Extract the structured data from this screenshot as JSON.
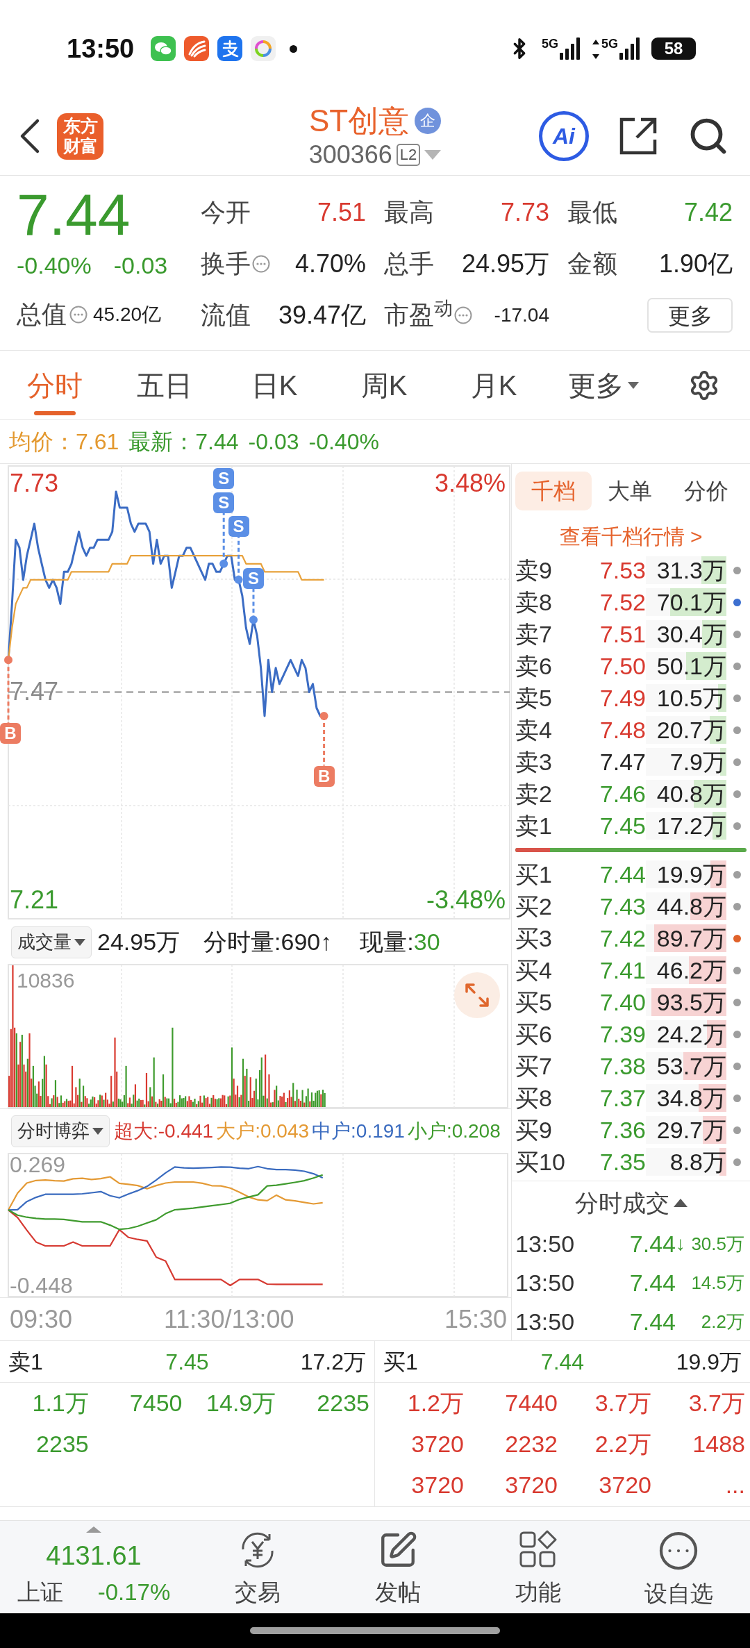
{
  "status_bar": {
    "time": "13:50",
    "networks": [
      {
        "label": "5G",
        "arrows": false
      },
      {
        "label": "5G",
        "arrows": true
      }
    ],
    "battery": "58"
  },
  "header": {
    "logo": "东方财富",
    "title": "ST创意",
    "badge": "企",
    "code": "300366",
    "code_tag": "L2",
    "ai": "Ai"
  },
  "quote": {
    "price": "7.44",
    "color": "#3a9a2e",
    "change_pct": "-0.40%",
    "change": "-0.03",
    "total_value": {
      "label": "总值",
      "value": "45.20亿",
      "info": true
    },
    "stats": [
      {
        "label": "今开",
        "value": "7.51",
        "color": "#d8392f",
        "info": false,
        "kind": "normal"
      },
      {
        "label": "最高",
        "value": "7.73",
        "color": "#d8392f",
        "info": false,
        "kind": "normal"
      },
      {
        "label": "最低",
        "value": "7.42",
        "color": "#3a9a2e",
        "info": false,
        "kind": "normal"
      },
      {
        "label": "换手",
        "value": "4.70%",
        "color": "#222222",
        "info": true,
        "kind": "normal"
      },
      {
        "label": "总手",
        "value": "24.95万",
        "color": "#222222",
        "info": false,
        "kind": "normal"
      },
      {
        "label": "金额",
        "value": "1.90亿",
        "color": "#222222",
        "info": false,
        "kind": "normal"
      },
      {
        "label": "流值",
        "value": "39.47亿",
        "color": "#222222",
        "info": false,
        "kind": "normal"
      },
      {
        "label": "市盈$^{动}$",
        "value": "-17.04",
        "color": "#222222",
        "info": true,
        "kind": "compact"
      }
    ],
    "more_button": "更多"
  },
  "tabs": [
    {
      "label": "分时",
      "selected": true,
      "kind": "tab"
    },
    {
      "label": "五日",
      "selected": false,
      "kind": "tab"
    },
    {
      "label": "日K",
      "selected": false,
      "kind": "tab"
    },
    {
      "label": "周K",
      "selected": false,
      "kind": "tab"
    },
    {
      "label": "月K",
      "selected": false,
      "kind": "tab"
    },
    {
      "label": "更多",
      "selected": false,
      "kind": "menu"
    }
  ],
  "summary": [
    {
      "text": "均价：7.61",
      "kind": "average"
    },
    {
      "text": "最新：7.44",
      "kind": "latest"
    },
    {
      "text": "-0.03",
      "kind": "latest"
    },
    {
      "text": "-0.40%",
      "kind": "latest"
    }
  ],
  "price_chart": {
    "pct_labels": [
      {
        "text": "3.48%",
        "color": "#d8392f"
      },
      {
        "text": "-3.48%",
        "color": "#3a9a2e"
      }
    ],
    "markers": [
      {
        "kind": "buy",
        "text": "B"
      },
      {
        "kind": "sell",
        "text": "S"
      },
      {
        "kind": "sell",
        "text": "S"
      },
      {
        "kind": "sell",
        "text": "S"
      },
      {
        "kind": "sell",
        "text": "S"
      },
      {
        "kind": "buy",
        "text": "B"
      }
    ],
    "chart_data": {
      "type": "line",
      "categories": [
        null,
        null,
        null,
        null,
        null,
        null,
        null,
        null,
        null,
        null,
        null,
        null,
        null,
        null,
        null,
        null,
        null,
        null,
        null,
        null,
        null,
        null,
        null,
        null,
        null,
        null,
        null,
        null,
        null,
        null,
        null,
        null,
        null,
        null,
        null,
        null,
        null,
        null,
        null,
        null,
        null,
        null,
        null,
        null,
        null,
        null,
        null,
        null,
        null,
        null,
        null,
        null,
        null,
        null,
        null,
        null,
        null,
        null,
        null,
        null,
        null,
        null,
        null,
        null,
        null,
        null,
        null,
        null,
        null,
        null,
        null,
        null,
        null,
        null,
        null,
        null,
        null,
        null,
        null,
        null,
        null,
        null,
        null,
        null,
        null,
        null,
        null,
        null,
        null,
        null,
        null,
        null,
        null,
        null,
        null,
        null,
        null,
        null,
        null,
        null,
        null,
        null,
        null,
        null,
        null,
        null,
        null,
        null,
        null,
        null,
        null,
        null,
        null,
        null,
        null,
        null,
        null,
        null,
        null,
        null,
        null,
        null,
        null,
        null,
        null,
        null,
        null,
        null,
        null,
        null,
        null,
        null,
        null,
        null,
        null,
        null
      ],
      "series": [
        {
          "color": "#3b6cc4",
          "values": [
            7.51,
            7.58,
            7.66,
            7.65,
            7.61,
            7.64,
            7.66,
            7.68,
            7.65,
            7.63,
            7.61,
            7.6,
            7.61,
            7.6,
            7.58,
            7.62,
            7.62,
            7.63,
            7.65,
            7.67,
            7.65,
            7.64,
            7.65,
            7.65,
            7.66,
            7.66,
            7.66,
            7.66,
            7.67,
            7.72,
            7.7,
            7.7,
            7.7,
            7.68,
            7.67,
            7.68,
            7.68,
            7.68,
            7.67,
            7.63,
            7.66,
            7.63,
            7.64,
            7.64,
            7.6,
            7.62,
            7.64,
            7.64,
            7.65,
            7.65,
            7.64,
            7.63,
            7.62,
            7.61,
            7.63,
            7.63,
            7.62,
            7.62,
            7.63,
            7.64,
            7.64,
            7.61,
            7.61,
            7.59,
            7.55,
            7.53,
            7.56,
            7.54,
            7.5,
            7.44,
            7.51,
            7.47,
            7.5,
            7.48,
            7.49,
            7.5,
            7.51,
            7.5,
            7.49,
            7.51,
            7.5,
            7.47,
            7.48,
            7.45,
            7.44,
            7.44,
            null,
            null,
            null,
            null,
            null,
            null,
            null,
            null,
            null,
            null,
            null,
            null,
            null,
            null,
            null,
            null,
            null,
            null,
            null,
            null,
            null,
            null,
            null,
            null,
            null,
            null,
            null,
            null,
            null,
            null,
            null,
            null,
            null,
            null,
            null,
            null,
            null,
            null,
            null,
            null,
            null,
            null,
            null,
            null,
            null,
            null,
            null,
            null,
            null,
            null
          ]
        },
        {
          "color": "#e8a23c",
          "values": [
            7.51,
            7.55,
            7.58,
            7.59,
            7.6,
            7.6,
            7.61,
            7.61,
            7.61,
            7.61,
            7.61,
            7.61,
            7.61,
            7.61,
            7.61,
            7.61,
            7.61,
            7.62,
            7.62,
            7.62,
            7.62,
            7.62,
            7.62,
            7.62,
            7.62,
            7.62,
            7.62,
            7.62,
            7.63,
            7.63,
            7.63,
            7.63,
            7.63,
            7.64,
            7.64,
            7.64,
            7.64,
            7.64,
            7.64,
            7.64,
            7.64,
            7.64,
            7.64,
            7.64,
            7.64,
            7.64,
            7.64,
            7.64,
            7.64,
            7.64,
            7.64,
            7.64,
            7.64,
            7.64,
            7.64,
            7.64,
            7.64,
            7.64,
            7.64,
            7.64,
            7.64,
            7.64,
            7.64,
            7.64,
            7.63,
            7.63,
            7.63,
            7.63,
            7.63,
            7.62,
            7.62,
            7.62,
            7.62,
            7.62,
            7.62,
            7.62,
            7.62,
            7.62,
            7.62,
            7.61,
            7.61,
            7.61,
            7.61,
            7.61,
            7.61,
            7.61,
            null,
            null,
            null,
            null,
            null,
            null,
            null,
            null,
            null,
            null,
            null,
            null,
            null,
            null,
            null,
            null,
            null,
            null,
            null,
            null,
            null,
            null,
            null,
            null,
            null,
            null,
            null,
            null,
            null,
            null,
            null,
            null,
            null,
            null,
            null,
            null,
            null,
            null,
            null,
            null,
            null,
            null,
            null,
            null,
            null,
            null,
            null,
            null,
            null,
            null
          ]
        }
      ],
      "ylim": [
        7.187,
        7.752
      ],
      "yticks": [
        {
          "value": 7.73,
          "label": "7.73"
        },
        {
          "value": 7.47,
          "label": "7.47"
        },
        {
          "value": 7.21,
          "label": "7.21"
        }
      ],
      "ref_lines": [
        {
          "axis": "y",
          "value": 7.47
        }
      ],
      "grid": true
    }
  },
  "volume": {
    "selector": "成交量",
    "total": "24.95万",
    "minute_volume": "分时量:690↑",
    "current_label": "现量:",
    "current": {
      "text": "30",
      "color": "#3a9a2e"
    },
    "max_label": "10836"
  },
  "flow": {
    "selector": "分时博弈",
    "legend": [
      "超大:-0.441",
      "大户:0.043",
      "中户:0.191",
      "小户:0.208"
    ],
    "chart_data": {
      "type": "line",
      "categories": [
        null,
        null,
        null,
        null,
        null,
        null,
        null,
        null,
        null,
        null,
        null,
        null,
        null,
        null,
        null,
        null,
        null,
        null,
        null,
        null,
        null,
        null,
        null,
        null,
        null,
        null,
        null,
        null,
        null,
        null,
        null,
        null,
        null,
        null,
        null,
        null,
        null,
        null,
        null,
        null,
        null,
        null,
        null,
        null,
        null,
        null,
        null,
        null,
        null,
        null,
        null,
        null,
        null,
        null,
        null
      ],
      "series": [
        {
          "color": "#d63a32",
          "values": [
            0,
            -0.045,
            -0.12,
            -0.19,
            -0.213,
            -0.213,
            -0.213,
            -0.19,
            -0.213,
            -0.213,
            -0.213,
            -0.213,
            -0.117,
            -0.163,
            -0.175,
            -0.184,
            -0.28,
            -0.303,
            -0.412,
            -0.412,
            -0.412,
            -0.412,
            -0.412,
            -0.412,
            -0.448,
            -0.412,
            -0.412,
            -0.412,
            -0.44,
            -0.441,
            -0.441,
            -0.441,
            -0.441,
            -0.441,
            -0.441,
            null,
            null,
            null,
            null,
            null,
            null,
            null,
            null,
            null,
            null,
            null,
            null,
            null,
            null,
            null,
            null,
            null,
            null,
            null,
            null
          ]
        },
        {
          "color": "#e49a35",
          "values": [
            0,
            0.1,
            0.16,
            0.175,
            0.178,
            0.174,
            0.172,
            0.185,
            0.188,
            0.181,
            0.186,
            0.197,
            0.158,
            0.152,
            0.145,
            0.126,
            0.145,
            0.16,
            0.166,
            0.166,
            0.166,
            0.158,
            0.144,
            0.143,
            0.13,
            0.105,
            0.077,
            0.06,
            0.055,
            0.088,
            0.06,
            0.054,
            0.045,
            0.036,
            0.043,
            null,
            null,
            null,
            null,
            null,
            null,
            null,
            null,
            null,
            null,
            null,
            null,
            null,
            null,
            null,
            null,
            null,
            null,
            null,
            null
          ]
        },
        {
          "color": "#3a6bbf",
          "values": [
            0,
            0.002,
            0.05,
            0.075,
            0.093,
            0.093,
            0.093,
            0.093,
            0.096,
            0.102,
            0.109,
            0.085,
            0.072,
            0.095,
            0.115,
            0.14,
            0.178,
            0.22,
            0.255,
            0.25,
            0.248,
            0.25,
            0.252,
            0.255,
            0.254,
            0.248,
            0.245,
            0.258,
            0.245,
            0.24,
            0.24,
            0.237,
            0.23,
            0.215,
            0.191,
            null,
            null,
            null,
            null,
            null,
            null,
            null,
            null,
            null,
            null,
            null,
            null,
            null,
            null,
            null,
            null,
            null,
            null,
            null,
            null
          ]
        },
        {
          "color": "#3f9b2e",
          "values": [
            0,
            -0.031,
            -0.043,
            -0.05,
            -0.054,
            -0.054,
            -0.056,
            -0.063,
            -0.07,
            -0.07,
            -0.07,
            -0.09,
            -0.115,
            -0.11,
            -0.097,
            -0.077,
            -0.058,
            -0.022,
            0.001,
            0.006,
            0.011,
            0.018,
            0.025,
            0.032,
            0.04,
            0.063,
            0.077,
            0.09,
            0.143,
            0.147,
            0.155,
            0.164,
            0.174,
            0.19,
            0.208,
            null,
            null,
            null,
            null,
            null,
            null,
            null,
            null,
            null,
            null,
            null,
            null,
            null,
            null,
            null,
            null,
            null,
            null,
            null,
            null
          ]
        }
      ],
      "ylim": [
        -0.514,
        0.335
      ],
      "yticks": [
        {
          "value": 0.269,
          "label": "0.269"
        },
        {
          "value": -0.448,
          "label": "-0.448"
        }
      ],
      "grid": true
    }
  },
  "time_axis": [
    "09:30",
    "11:30/13:00",
    "15:30"
  ],
  "order_book": {
    "tabs": [
      {
        "label": "千档",
        "selected": true
      },
      {
        "label": "大单",
        "selected": false
      },
      {
        "label": "分价",
        "selected": false
      }
    ],
    "link": "查看千档行情 >",
    "sell": [
      {
        "label": "卖9",
        "price": {
          "text": "7.53",
          "color": "#d8392f"
        },
        "volume": "31.3万",
        "level": 0.313,
        "color": "#9e9e9e"
      },
      {
        "label": "卖8",
        "price": {
          "text": "7.52",
          "color": "#d8392f"
        },
        "volume": "70.1万",
        "level": 0.701,
        "color": "#3d6fd0"
      },
      {
        "label": "卖7",
        "price": {
          "text": "7.51",
          "color": "#d8392f"
        },
        "volume": "30.4万",
        "level": 0.304,
        "color": "#9e9e9e"
      },
      {
        "label": "卖6",
        "price": {
          "text": "7.50",
          "color": "#d8392f"
        },
        "volume": "50.1万",
        "level": 0.501,
        "color": "#9e9e9e"
      },
      {
        "label": "卖5",
        "price": {
          "text": "7.49",
          "color": "#d8392f"
        },
        "volume": "10.5万",
        "level": 0.105,
        "color": "#9e9e9e"
      },
      {
        "label": "卖4",
        "price": {
          "text": "7.48",
          "color": "#d8392f"
        },
        "volume": "20.7万",
        "level": 0.207,
        "color": "#9e9e9e"
      },
      {
        "label": "卖3",
        "price": {
          "text": "7.47",
          "color": "#222222"
        },
        "volume": "7.9万",
        "level": 0.079,
        "color": "#9e9e9e"
      },
      {
        "label": "卖2",
        "price": {
          "text": "7.46",
          "color": "#3a9a2e"
        },
        "volume": "40.8万",
        "level": 0.408,
        "color": "#9e9e9e"
      },
      {
        "label": "卖1",
        "price": {
          "text": "7.45",
          "color": "#3a9a2e"
        },
        "volume": "17.2万",
        "level": 0.172,
        "color": "#9e9e9e"
      }
    ],
    "ratio": {
      "level": 0.15
    },
    "buy": [
      {
        "label": "买1",
        "price": {
          "text": "7.44",
          "color": "#3a9a2e"
        },
        "volume": "19.9万",
        "level": 0.199,
        "color": "#9e9e9e"
      },
      {
        "label": "买2",
        "price": {
          "text": "7.43",
          "color": "#3a9a2e"
        },
        "volume": "44.8万",
        "level": 0.448,
        "color": "#9e9e9e"
      },
      {
        "label": "买3",
        "price": {
          "text": "7.42",
          "color": "#3a9a2e"
        },
        "volume": "89.7万",
        "level": 0.897,
        "color": "#e0622a"
      },
      {
        "label": "买4",
        "price": {
          "text": "7.41",
          "color": "#3a9a2e"
        },
        "volume": "46.2万",
        "level": 0.462,
        "color": "#9e9e9e"
      },
      {
        "label": "买5",
        "price": {
          "text": "7.40",
          "color": "#3a9a2e"
        },
        "volume": "93.5万",
        "level": 0.935,
        "color": "#9e9e9e"
      },
      {
        "label": "买6",
        "price": {
          "text": "7.39",
          "color": "#3a9a2e"
        },
        "volume": "24.2万",
        "level": 0.242,
        "color": "#9e9e9e"
      },
      {
        "label": "买7",
        "price": {
          "text": "7.38",
          "color": "#3a9a2e"
        },
        "volume": "53.7万",
        "level": 0.537,
        "color": "#9e9e9e"
      },
      {
        "label": "买8",
        "price": {
          "text": "7.37",
          "color": "#3a9a2e"
        },
        "volume": "34.8万",
        "level": 0.348,
        "color": "#9e9e9e"
      },
      {
        "label": "买9",
        "price": {
          "text": "7.36",
          "color": "#3a9a2e"
        },
        "volume": "29.7万",
        "level": 0.297,
        "color": "#9e9e9e"
      },
      {
        "label": "买10",
        "price": {
          "text": "7.35",
          "color": "#3a9a2e"
        },
        "volume": "8.8万",
        "level": 0.088,
        "color": "#9e9e9e"
      }
    ]
  },
  "trades": {
    "title": "分时成交",
    "rows": [
      {
        "time": "13:50",
        "price": "7.44",
        "tick": "↓",
        "volume": "30.5万",
        "color": "#3a9a2e"
      },
      {
        "time": "13:50",
        "price": "7.44",
        "volume": "14.5万",
        "color": "#3a9a2e"
      },
      {
        "time": "13:50",
        "price": "7.44",
        "volume": "2.2万",
        "color": "#3a9a2e"
      }
    ]
  },
  "best_orders": {
    "sides": [
      {
        "label": "卖1",
        "price": {
          "text": "7.45",
          "color": "#3a9a2e"
        },
        "volume": "17.2万",
        "orders": {
          "color": "#3a9a2e",
          "items": [
            "1.1万",
            "7450",
            "14.9万",
            "2235",
            "2235"
          ]
        }
      },
      {
        "label": "买1",
        "price": {
          "text": "7.44",
          "color": "#3a9a2e"
        },
        "volume": "19.9万",
        "orders": {
          "color": "#d8392f",
          "items": [
            "1.2万",
            "7440",
            "3.7万",
            "3.7万",
            "3720",
            "2232",
            "2.2万",
            "1488",
            "3720",
            "3720",
            "3720",
            "..."
          ]
        }
      }
    ]
  },
  "nav": {
    "index": {
      "value": "4131.61",
      "name": "上证",
      "change": "-0.17%",
      "color": "#3a9a2e"
    },
    "items": [
      {
        "label": "交易",
        "kind": "trade"
      },
      {
        "label": "发帖",
        "kind": "post"
      },
      {
        "label": "功能",
        "kind": "tools"
      },
      {
        "label": "设自选",
        "kind": "watch"
      }
    ]
  }
}
